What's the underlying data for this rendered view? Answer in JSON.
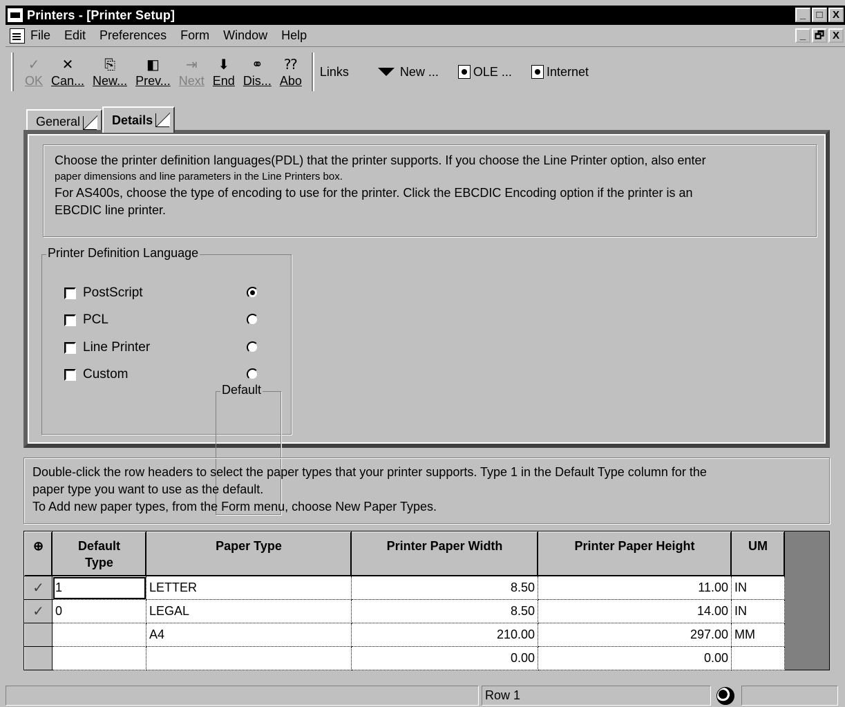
{
  "window": {
    "title": "Printers - [Printer Setup]",
    "min": "_",
    "max": "□",
    "close": "X",
    "mdi_min": "_",
    "mdi_restore": "🗗",
    "mdi_close": "X"
  },
  "menu": {
    "items": [
      "File",
      "Edit",
      "Preferences",
      "Form",
      "Window",
      "Help"
    ]
  },
  "toolbar": {
    "ok": "OK",
    "cancel": "Can...",
    "new": "New...",
    "prev": "Prev...",
    "next": "Next",
    "end": "End",
    "dis": "Dis...",
    "abo": "Abo",
    "links": "Links",
    "new_link": "New ...",
    "ole": "OLE ...",
    "internet": "Internet"
  },
  "tabs": {
    "general": "General",
    "details": "Details"
  },
  "details": {
    "help_line1": "Choose the printer definition languages(PDL) that the printer supports. If you choose the Line Printer option, also enter",
    "help_line2": "paper dimensions and line parameters in the Line Printers box.",
    "help_line3": "For AS400s, choose the type of encoding to use for the printer. Click the EBCDIC Encoding option if the printer is an",
    "help_line4": "EBCDIC line printer.",
    "pdl_legend": "Printer Definition Language",
    "default_legend": "Default",
    "options": [
      {
        "label": "PostScript",
        "checked": false,
        "default": true
      },
      {
        "label": "PCL",
        "checked": false,
        "default": false
      },
      {
        "label": "Line Printer",
        "checked": false,
        "default": false
      },
      {
        "label": "Custom",
        "checked": false,
        "default": false
      }
    ]
  },
  "paper_help": {
    "line1": "Double-click the row headers to select the paper types that your printer supports.  Type 1 in the Default Type column for the",
    "line2": "paper type you want to use as the default.",
    "line3": "To Add new paper types, from the Form menu, choose New Paper Types."
  },
  "grid": {
    "headers": {
      "default_type_1": "Default",
      "default_type_2": "Type",
      "paper_type": "Paper Type",
      "width": "Printer Paper Width",
      "height": "Printer Paper Height",
      "um": "UM"
    },
    "rows": [
      {
        "selected": "✓",
        "default_type": "1",
        "paper_type": "LETTER",
        "width": "8.50",
        "height": "11.00",
        "um": "IN"
      },
      {
        "selected": "✓",
        "default_type": "0",
        "paper_type": "LEGAL",
        "width": "8.50",
        "height": "14.00",
        "um": "IN"
      },
      {
        "selected": "",
        "default_type": "",
        "paper_type": "A4",
        "width": "210.00",
        "height": "297.00",
        "um": "MM"
      },
      {
        "selected": "",
        "default_type": "",
        "paper_type": "",
        "width": "0.00",
        "height": "0.00",
        "um": ""
      }
    ]
  },
  "status": {
    "row": "Row 1"
  }
}
